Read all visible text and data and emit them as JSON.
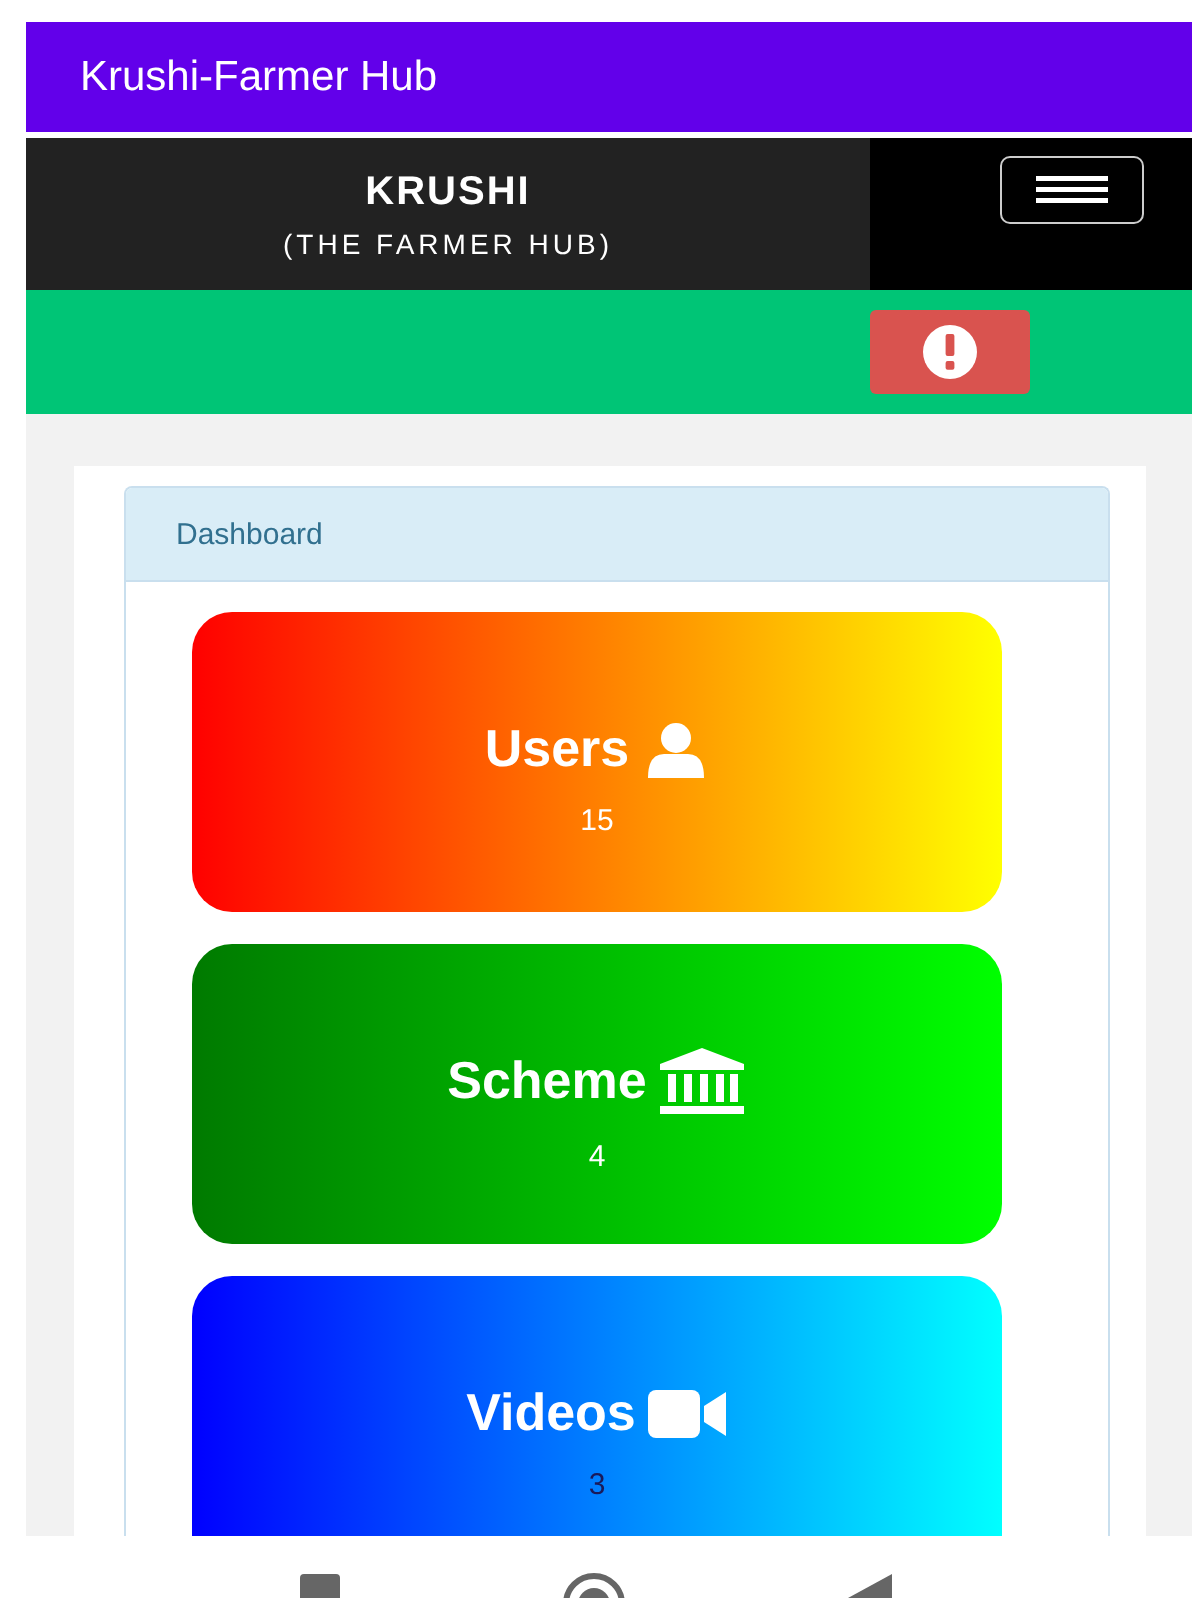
{
  "app_bar": {
    "title": "Krushi-Farmer Hub"
  },
  "header": {
    "brand": "KRUSHI",
    "tagline": "(THE FARMER HUB)"
  },
  "panel": {
    "heading": "Dashboard"
  },
  "tiles": [
    {
      "kind": "users",
      "label": "Users",
      "count": "15"
    },
    {
      "kind": "scheme",
      "label": "Scheme",
      "count": "4"
    },
    {
      "kind": "videos",
      "label": "Videos",
      "count": "3"
    }
  ]
}
